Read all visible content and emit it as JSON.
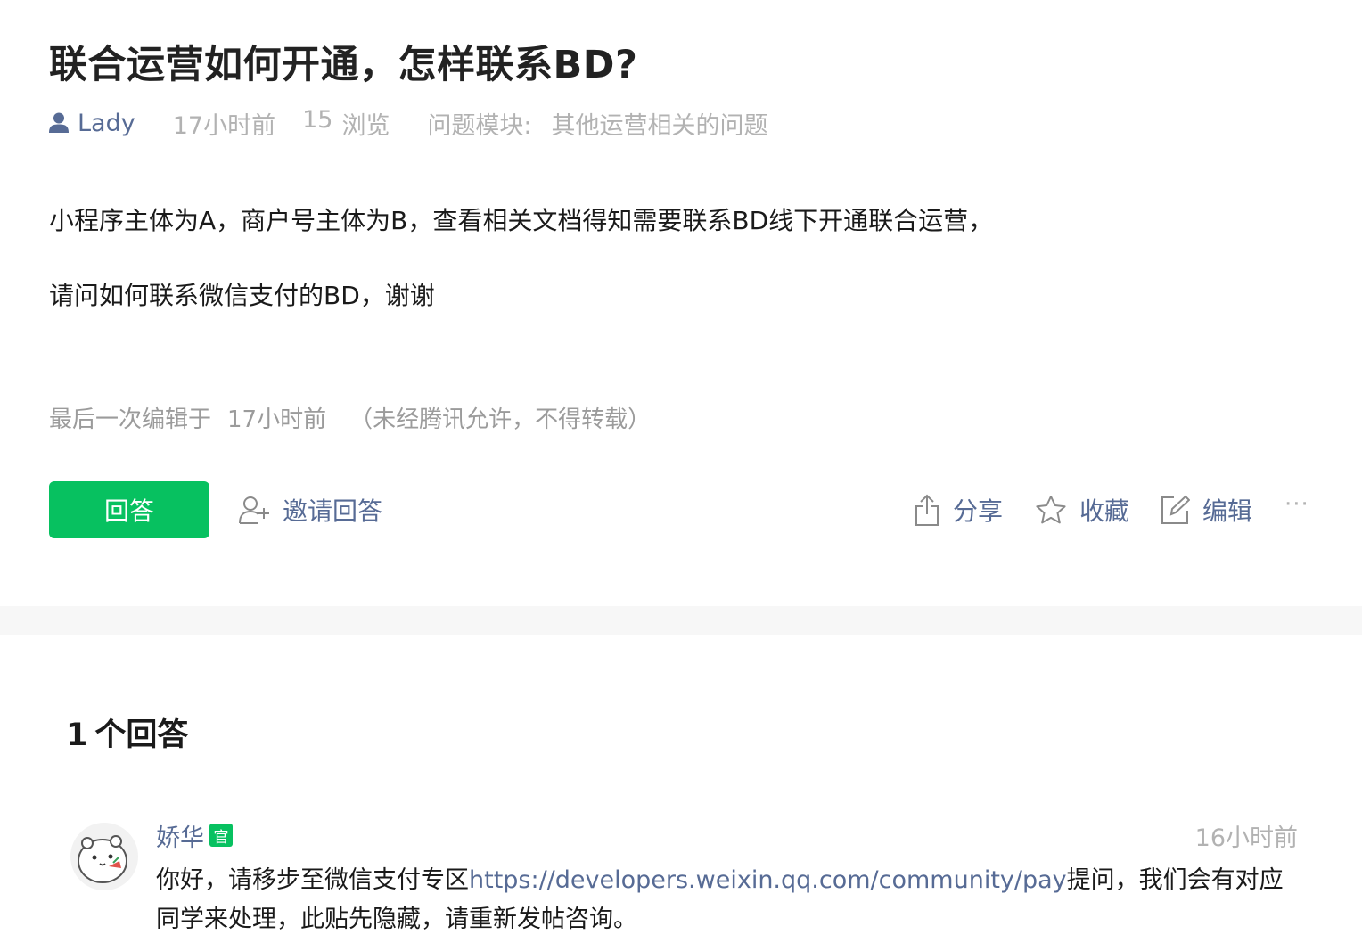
{
  "question": {
    "title": "联合运营如何开通，怎样联系BD?",
    "author": "Lady",
    "time": "17小时前",
    "views_count": "15",
    "views_label": "浏览",
    "module_label": "问题模块:",
    "module_value": "其他运营相关的问题",
    "body_line1": "小程序主体为A，商户号主体为B，查看相关文档得知需要联系BD线下开通联合运营，",
    "body_line2": "请问如何联系微信支付的BD，谢谢",
    "edit_prefix": "最后一次编辑于",
    "edit_time": "17小时前",
    "copyright": "（未经腾讯允许，不得转载）"
  },
  "actions": {
    "answer_label": "回答",
    "invite_label": "邀请回答",
    "share_label": "分享",
    "favorite_label": "收藏",
    "edit_label": "编辑",
    "more_label": "···"
  },
  "answers": {
    "count": "1",
    "count_suffix": "个回答",
    "items": [
      {
        "author": "娇华",
        "badge": "官",
        "time": "16小时前",
        "text_before": "你好，请移步至微信支付专区",
        "link": "https://developers.weixin.qq.com/community/pay",
        "text_after": "提问，我们会有对应同学来处理，此贴先隐藏，请重新发帖咨询。"
      }
    ]
  },
  "colors": {
    "accent_green": "#07c160",
    "link_blue": "#576b95",
    "muted_gray": "#b2b2b2",
    "divider_bg": "#f7f7f7"
  }
}
